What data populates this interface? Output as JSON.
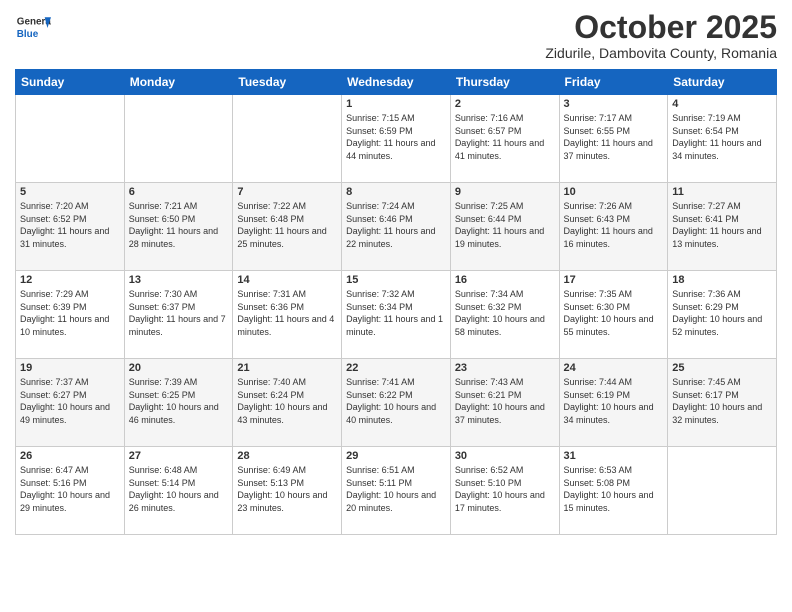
{
  "header": {
    "logo": {
      "general": "General",
      "blue": "Blue"
    },
    "title": "October 2025",
    "subtitle": "Zidurile, Dambovita County, Romania"
  },
  "days_of_week": [
    "Sunday",
    "Monday",
    "Tuesday",
    "Wednesday",
    "Thursday",
    "Friday",
    "Saturday"
  ],
  "weeks": [
    [
      {
        "day": "",
        "info": ""
      },
      {
        "day": "",
        "info": ""
      },
      {
        "day": "",
        "info": ""
      },
      {
        "day": "1",
        "info": "Sunrise: 7:15 AM\nSunset: 6:59 PM\nDaylight: 11 hours and 44 minutes."
      },
      {
        "day": "2",
        "info": "Sunrise: 7:16 AM\nSunset: 6:57 PM\nDaylight: 11 hours and 41 minutes."
      },
      {
        "day": "3",
        "info": "Sunrise: 7:17 AM\nSunset: 6:55 PM\nDaylight: 11 hours and 37 minutes."
      },
      {
        "day": "4",
        "info": "Sunrise: 7:19 AM\nSunset: 6:54 PM\nDaylight: 11 hours and 34 minutes."
      }
    ],
    [
      {
        "day": "5",
        "info": "Sunrise: 7:20 AM\nSunset: 6:52 PM\nDaylight: 11 hours and 31 minutes."
      },
      {
        "day": "6",
        "info": "Sunrise: 7:21 AM\nSunset: 6:50 PM\nDaylight: 11 hours and 28 minutes."
      },
      {
        "day": "7",
        "info": "Sunrise: 7:22 AM\nSunset: 6:48 PM\nDaylight: 11 hours and 25 minutes."
      },
      {
        "day": "8",
        "info": "Sunrise: 7:24 AM\nSunset: 6:46 PM\nDaylight: 11 hours and 22 minutes."
      },
      {
        "day": "9",
        "info": "Sunrise: 7:25 AM\nSunset: 6:44 PM\nDaylight: 11 hours and 19 minutes."
      },
      {
        "day": "10",
        "info": "Sunrise: 7:26 AM\nSunset: 6:43 PM\nDaylight: 11 hours and 16 minutes."
      },
      {
        "day": "11",
        "info": "Sunrise: 7:27 AM\nSunset: 6:41 PM\nDaylight: 11 hours and 13 minutes."
      }
    ],
    [
      {
        "day": "12",
        "info": "Sunrise: 7:29 AM\nSunset: 6:39 PM\nDaylight: 11 hours and 10 minutes."
      },
      {
        "day": "13",
        "info": "Sunrise: 7:30 AM\nSunset: 6:37 PM\nDaylight: 11 hours and 7 minutes."
      },
      {
        "day": "14",
        "info": "Sunrise: 7:31 AM\nSunset: 6:36 PM\nDaylight: 11 hours and 4 minutes."
      },
      {
        "day": "15",
        "info": "Sunrise: 7:32 AM\nSunset: 6:34 PM\nDaylight: 11 hours and 1 minute."
      },
      {
        "day": "16",
        "info": "Sunrise: 7:34 AM\nSunset: 6:32 PM\nDaylight: 10 hours and 58 minutes."
      },
      {
        "day": "17",
        "info": "Sunrise: 7:35 AM\nSunset: 6:30 PM\nDaylight: 10 hours and 55 minutes."
      },
      {
        "day": "18",
        "info": "Sunrise: 7:36 AM\nSunset: 6:29 PM\nDaylight: 10 hours and 52 minutes."
      }
    ],
    [
      {
        "day": "19",
        "info": "Sunrise: 7:37 AM\nSunset: 6:27 PM\nDaylight: 10 hours and 49 minutes."
      },
      {
        "day": "20",
        "info": "Sunrise: 7:39 AM\nSunset: 6:25 PM\nDaylight: 10 hours and 46 minutes."
      },
      {
        "day": "21",
        "info": "Sunrise: 7:40 AM\nSunset: 6:24 PM\nDaylight: 10 hours and 43 minutes."
      },
      {
        "day": "22",
        "info": "Sunrise: 7:41 AM\nSunset: 6:22 PM\nDaylight: 10 hours and 40 minutes."
      },
      {
        "day": "23",
        "info": "Sunrise: 7:43 AM\nSunset: 6:21 PM\nDaylight: 10 hours and 37 minutes."
      },
      {
        "day": "24",
        "info": "Sunrise: 7:44 AM\nSunset: 6:19 PM\nDaylight: 10 hours and 34 minutes."
      },
      {
        "day": "25",
        "info": "Sunrise: 7:45 AM\nSunset: 6:17 PM\nDaylight: 10 hours and 32 minutes."
      }
    ],
    [
      {
        "day": "26",
        "info": "Sunrise: 6:47 AM\nSunset: 5:16 PM\nDaylight: 10 hours and 29 minutes."
      },
      {
        "day": "27",
        "info": "Sunrise: 6:48 AM\nSunset: 5:14 PM\nDaylight: 10 hours and 26 minutes."
      },
      {
        "day": "28",
        "info": "Sunrise: 6:49 AM\nSunset: 5:13 PM\nDaylight: 10 hours and 23 minutes."
      },
      {
        "day": "29",
        "info": "Sunrise: 6:51 AM\nSunset: 5:11 PM\nDaylight: 10 hours and 20 minutes."
      },
      {
        "day": "30",
        "info": "Sunrise: 6:52 AM\nSunset: 5:10 PM\nDaylight: 10 hours and 17 minutes."
      },
      {
        "day": "31",
        "info": "Sunrise: 6:53 AM\nSunset: 5:08 PM\nDaylight: 10 hours and 15 minutes."
      },
      {
        "day": "",
        "info": ""
      }
    ]
  ]
}
